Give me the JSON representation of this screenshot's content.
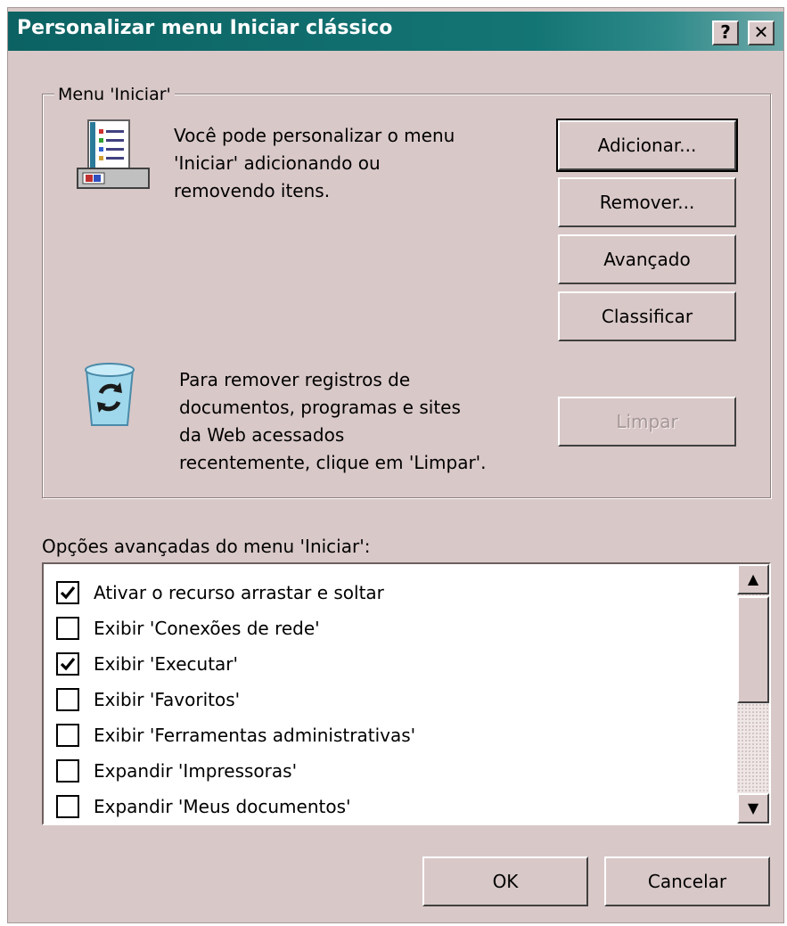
{
  "window": {
    "title": "Personalizar menu Iniciar clássico",
    "help_button": "?",
    "close_button": "✕"
  },
  "start_menu_group": {
    "label": "Menu 'Iniciar'",
    "customize_text": [
      "Você pode personalizar o menu",
      "'Iniciar' adicionando ou",
      "removendo itens."
    ],
    "clear_text": [
      "Para remover registros de",
      "documentos, programas e sites",
      "da Web acessados",
      "recentemente, clique em 'Limpar'."
    ],
    "buttons": {
      "add": "Adicionar...",
      "remove": "Remover...",
      "advanced": "Avançado",
      "sort": "Classificar",
      "clear": "Limpar"
    }
  },
  "advanced_options": {
    "label": "Opções avançadas do menu 'Iniciar':",
    "items": [
      {
        "label": "Ativar o recurso arrastar e soltar",
        "checked": true
      },
      {
        "label": "Exibir 'Conexões de rede'",
        "checked": false
      },
      {
        "label": "Exibir 'Executar'",
        "checked": true
      },
      {
        "label": "Exibir 'Favoritos'",
        "checked": false
      },
      {
        "label": "Exibir 'Ferramentas administrativas'",
        "checked": false
      },
      {
        "label": "Expandir 'Impressoras'",
        "checked": false
      },
      {
        "label": "Expandir 'Meus documentos'",
        "checked": false
      }
    ]
  },
  "footer": {
    "ok": "OK",
    "cancel": "Cancelar"
  },
  "icons": {
    "start_menu": "start-menu-icon",
    "recycle": "recycle-bin-icon",
    "checkmark": "checkmark-icon",
    "scroll_up": "scroll-up-arrow-icon",
    "scroll_down": "scroll-down-arrow-icon"
  },
  "colors": {
    "title_bar": "#0c6262",
    "dialog_face": "#d9c8c8"
  }
}
